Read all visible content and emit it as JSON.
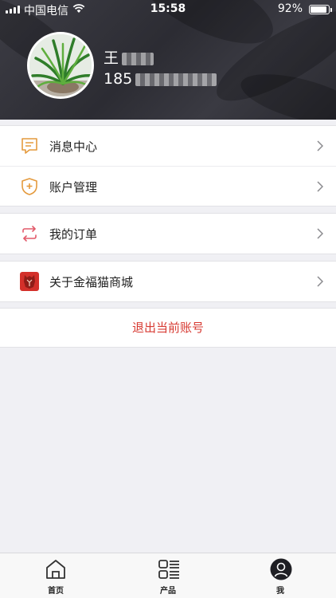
{
  "status_bar": {
    "carrier": "中国电信",
    "time": "15:58",
    "battery_percent": "92%",
    "battery_level": 0.92
  },
  "profile": {
    "name": "王",
    "phone": "185"
  },
  "menu_groups": [
    [
      {
        "label": "消息中心",
        "icon": "message-icon",
        "color": "#e49a3d"
      },
      {
        "label": "账户管理",
        "icon": "shield-icon",
        "color": "#e49a3d"
      }
    ],
    [
      {
        "label": "我的订单",
        "icon": "exchange-icon",
        "color": "#e25a6a"
      }
    ],
    [
      {
        "label": "关于金福猫商城",
        "icon": "brand-logo-icon",
        "color": "#d3302a"
      }
    ]
  ],
  "logout_label": "退出当前账号",
  "tabbar": {
    "items": [
      {
        "label": "首页",
        "icon": "home-icon"
      },
      {
        "label": "产品",
        "icon": "product-list-icon"
      },
      {
        "label": "我",
        "icon": "user-icon",
        "active": true
      }
    ]
  },
  "colors": {
    "accent_red": "#d73a32",
    "header_dark": "#34343b",
    "background": "#f0f0f4"
  }
}
